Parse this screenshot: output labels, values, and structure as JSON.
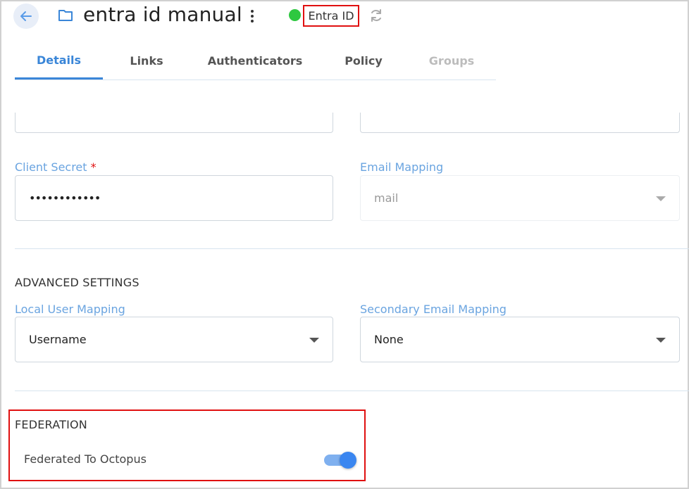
{
  "header": {
    "title": "entra id manual",
    "status_text": "Entra ID",
    "status_color": "#2ec840",
    "icons": {
      "back": "arrow-left-icon",
      "folder": "folder-icon",
      "more": "more-vert-icon",
      "sync": "sync-icon"
    }
  },
  "tabs": [
    {
      "label": "Details",
      "state": "active"
    },
    {
      "label": "Links",
      "state": "normal"
    },
    {
      "label": "Authenticators",
      "state": "normal"
    },
    {
      "label": "Policy",
      "state": "normal"
    },
    {
      "label": "Groups",
      "state": "disabled"
    }
  ],
  "form": {
    "client_secret": {
      "label": "Client Secret",
      "required_mark": "*",
      "value": "••••••••••••"
    },
    "email_mapping": {
      "label": "Email Mapping",
      "value": "mail"
    },
    "advanced_title": "ADVANCED SETTINGS",
    "local_user_mapping": {
      "label": "Local User Mapping",
      "value": "Username"
    },
    "secondary_email_mapping": {
      "label": "Secondary Email Mapping",
      "value": "None"
    },
    "federation_title": "FEDERATION",
    "federated_to_octopus": {
      "label": "Federated To Octopus",
      "enabled": true
    }
  },
  "colors": {
    "accent": "#3a86d8",
    "highlight_border": "#e01010",
    "label": "#6aa4e0"
  }
}
